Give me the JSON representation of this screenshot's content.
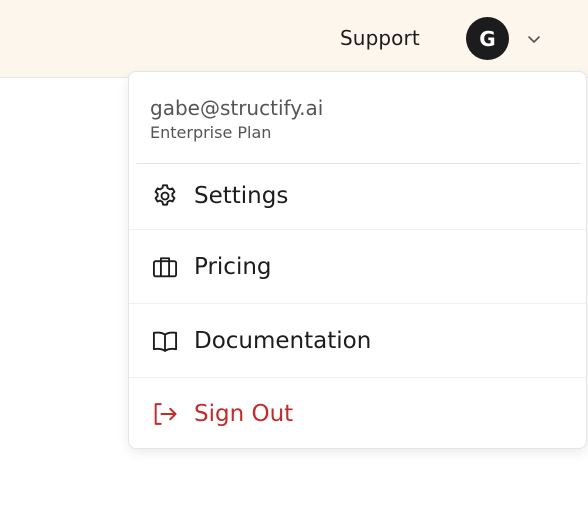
{
  "header": {
    "support_label": "Support",
    "avatar_initial": "G"
  },
  "menu": {
    "email": "gabe@structify.ai",
    "plan": "Enterprise Plan",
    "items": [
      {
        "label": "Settings",
        "icon": "gear-icon"
      },
      {
        "label": "Pricing",
        "icon": "briefcase-icon"
      },
      {
        "label": "Documentation",
        "icon": "book-icon"
      },
      {
        "label": "Sign Out",
        "icon": "sign-out-icon"
      }
    ]
  },
  "colors": {
    "topbar_bg": "#fdf6ec",
    "avatar_bg": "#1c1c1c",
    "danger": "#c42b2b"
  }
}
